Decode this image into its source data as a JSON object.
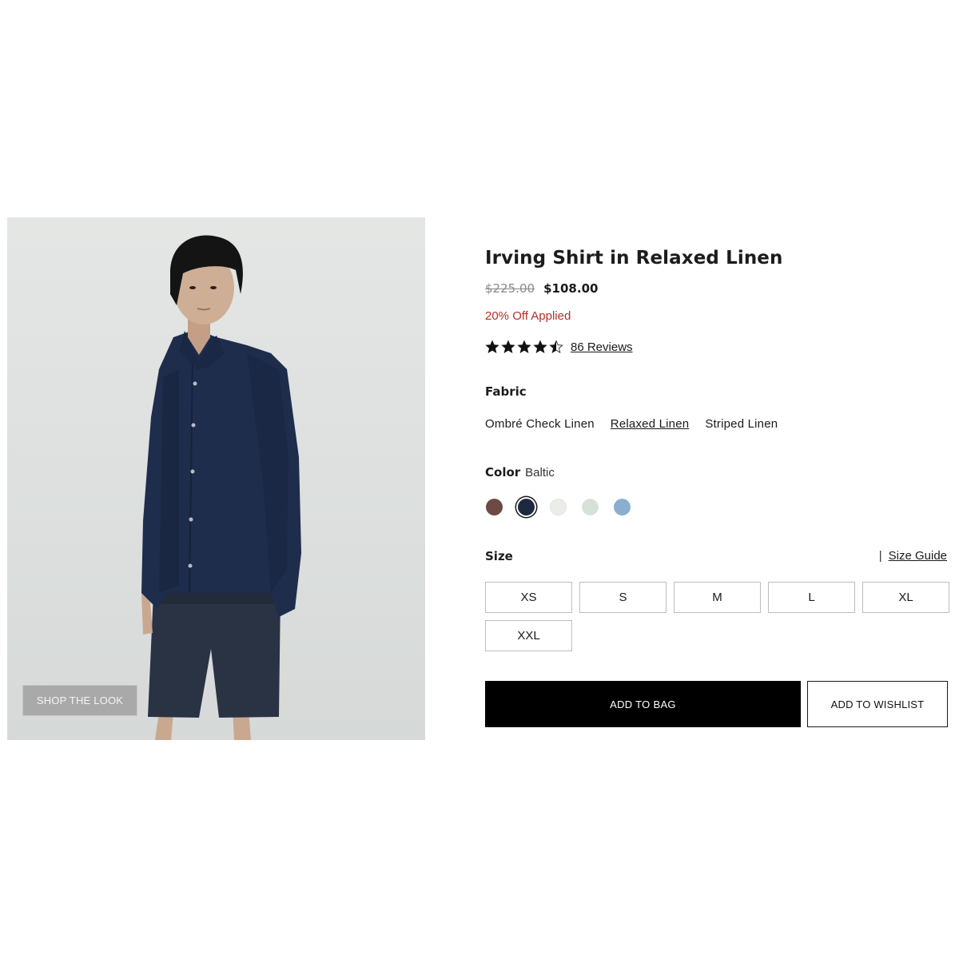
{
  "product_image": {
    "shop_the_look_label": "SHOP THE LOOK"
  },
  "product": {
    "title": "Irving Shirt in Relaxed Linen",
    "price_original": "$225.00",
    "price_sale": "$108.00",
    "discount_text": "20% Off Applied",
    "rating": 4.5,
    "reviews_label": "86 Reviews"
  },
  "fabric": {
    "label": "Fabric",
    "options": [
      "Ombré Check Linen",
      "Relaxed Linen",
      "Striped Linen"
    ],
    "selected": "Relaxed Linen"
  },
  "color": {
    "label": "Color",
    "selected_name": "Baltic",
    "swatches": [
      "#6e4a44",
      "#1c2940",
      "#ebeee8",
      "#d6e1d7",
      "#8aaed1"
    ],
    "selected_index": 1
  },
  "size": {
    "label": "Size",
    "separator": "|",
    "guide_label": "Size Guide",
    "options": [
      "XS",
      "S",
      "M",
      "L",
      "XL",
      "XXL"
    ]
  },
  "actions": {
    "add_to_bag": "ADD TO BAG",
    "add_to_wishlist": "ADD TO WISHLIST"
  }
}
